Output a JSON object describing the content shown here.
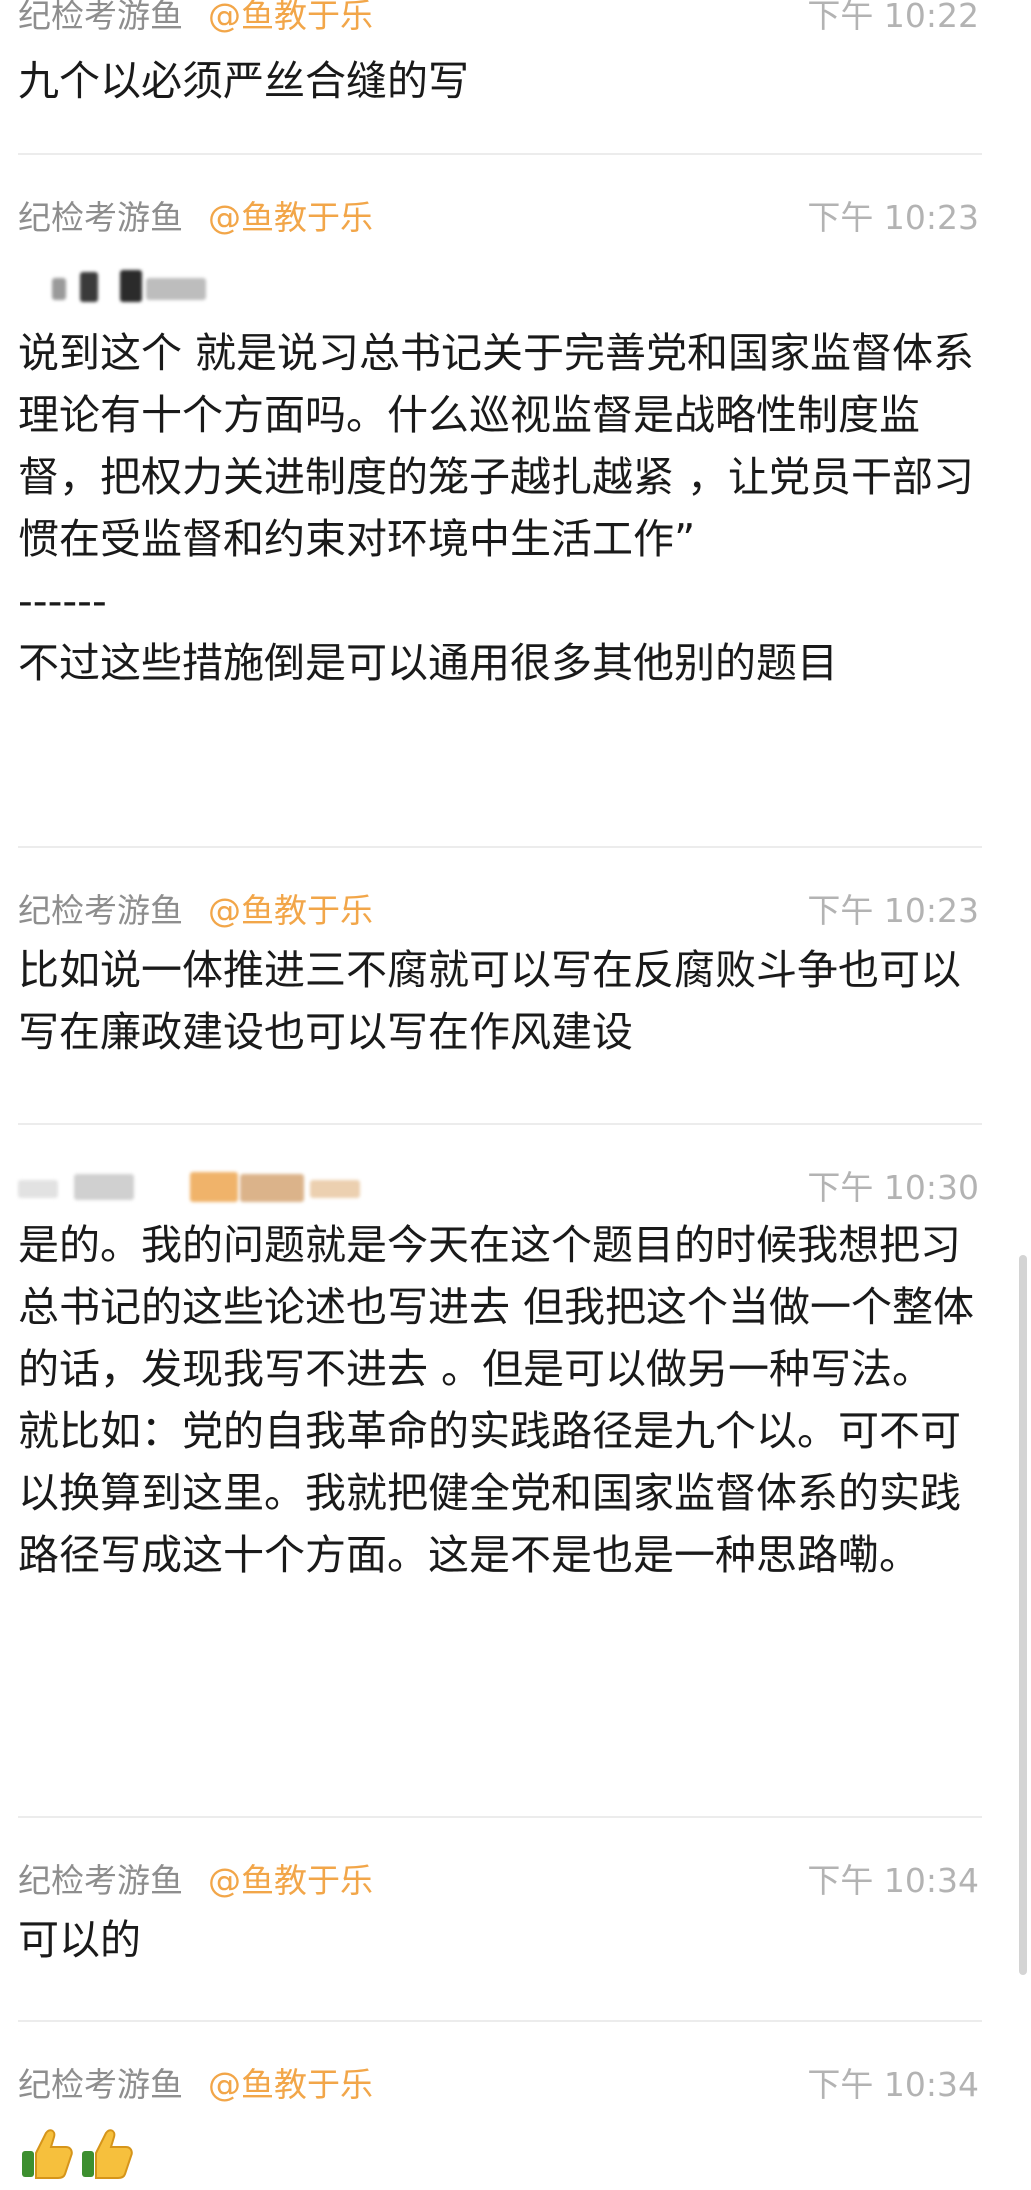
{
  "mention": "@鱼教于乐",
  "messages": [
    {
      "sender": "纪检考游鱼",
      "time": "下午 10:22",
      "text": "九个以必须严丝合缝的写"
    },
    {
      "sender": "纪检考游鱼",
      "time": "下午 10:23",
      "text": "说到这个 就是说习总书记关于完善党和国家监督体系理论有十个方面吗。什么巡视监督是战略性制度监督，把权力关进制度的笼子越扎越紧 ，让党员干部习惯在受监督和约束对环境中生活工作”\n------\n不过这些措施倒是可以通用很多其他别的题目"
    },
    {
      "sender": "纪检考游鱼",
      "time": "下午 10:23",
      "text": "比如说一体推进三不腐就可以写在反腐败斗争也可以写在廉政建设也可以写在作风建设"
    },
    {
      "time": "下午 10:30",
      "text": "是的。我的问题就是今天在这个题目的时候我想把习总书记的这些论述也写进去 但我把这个当做一个整体的话，发现我写不进去 。但是可以做另一种写法。\n就比如：党的自我革命的实践路径是九个以。可不可以换算到这里。我就把健全党和国家监督体系的实践路径写成这十个方面。这是不是也是一种思路嘞。"
    },
    {
      "sender": "纪检考游鱼",
      "time": "下午 10:34",
      "text": "可以的"
    },
    {
      "sender": "纪检考游鱼",
      "time": "下午 10:34",
      "icons": [
        "thumbs-up-icon",
        "thumbs-up-icon"
      ]
    }
  ]
}
